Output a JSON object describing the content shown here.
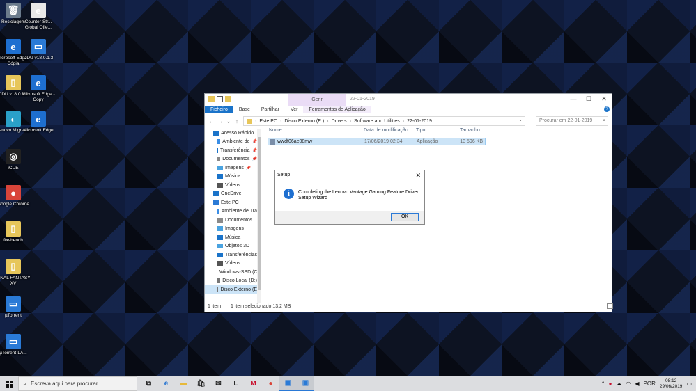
{
  "desktop": {
    "icons": [
      {
        "label": "Reciclagem",
        "glyph": "🗑",
        "color": "#6b7b8c"
      },
      {
        "label": "Counter-Str... Global Offe...",
        "glyph": "e",
        "color": "#e8e8e8"
      },
      {
        "label": "Microsoft Edge - Cópia",
        "glyph": "e",
        "color": "#1e6fd0"
      },
      {
        "label": "DDU v18.0.1.3",
        "glyph": "▭",
        "color": "#2a7ad6"
      },
      {
        "label": "DDU v18.0.1.3",
        "glyph": "▯",
        "color": "#e7c65a"
      },
      {
        "label": "Microsoft Edge - Copy",
        "glyph": "e",
        "color": "#1e6fd0"
      },
      {
        "label": "Lenovo Migrati...",
        "glyph": "◐",
        "color": "#2aa0c8"
      },
      {
        "label": "Microsoft Edge",
        "glyph": "e",
        "color": "#1e6fd0"
      },
      {
        "label": "iCUE",
        "glyph": "◎",
        "color": "#222"
      },
      {
        "label": "Google Chrome",
        "glyph": "●",
        "color": "#d9453a"
      },
      {
        "label": "ffxvbench",
        "glyph": "▯",
        "color": "#e7c65a"
      },
      {
        "label": "FINAL FANTASY XV",
        "glyph": "▯",
        "color": "#e7c65a"
      },
      {
        "label": "µTorrent",
        "glyph": "▭",
        "color": "#2a7ad6"
      },
      {
        "label": "µTorrent-LA...",
        "glyph": "▭",
        "color": "#2a7ad6"
      }
    ]
  },
  "explorer": {
    "tools_tab": "Gerir",
    "window_title": "22-01-2019",
    "controls": [
      "—",
      "☐",
      "✕"
    ],
    "ribbon_tabs": [
      "Ficheiro",
      "Base",
      "Partilhar",
      "Ver",
      "Ferramentas de Aplicação"
    ],
    "address": [
      "Este PC",
      "Disco Externo (E:)",
      "Drivers",
      "Software and Utilities",
      "22-01-2019"
    ],
    "search_placeholder": "Procurar em 22-01-2019",
    "nav_items": [
      {
        "label": "Acesso Rápido",
        "pin": false,
        "indent": 0,
        "color": "#1a73c9"
      },
      {
        "label": "Ambiente de",
        "pin": true,
        "indent": 1,
        "color": "#3a8ee6"
      },
      {
        "label": "Transferência",
        "pin": true,
        "indent": 1,
        "color": "#1a73c9"
      },
      {
        "label": "Documentos",
        "pin": true,
        "indent": 1,
        "color": "#8a8a8a"
      },
      {
        "label": "Imagens",
        "pin": true,
        "indent": 1,
        "color": "#4aa3e0"
      },
      {
        "label": "Música",
        "pin": false,
        "indent": 1,
        "color": "#1a73c9"
      },
      {
        "label": "Vídeos",
        "pin": false,
        "indent": 1,
        "color": "#555"
      },
      {
        "label": "OneDrive",
        "pin": false,
        "indent": 0,
        "color": "#1a73c9"
      },
      {
        "label": "Este PC",
        "pin": false,
        "indent": 0,
        "color": "#2a7ad6"
      },
      {
        "label": "Ambiente de Tra",
        "pin": false,
        "indent": 1,
        "color": "#3a8ee6"
      },
      {
        "label": "Documentos",
        "pin": false,
        "indent": 1,
        "color": "#8a8a8a"
      },
      {
        "label": "Imagens",
        "pin": false,
        "indent": 1,
        "color": "#4aa3e0"
      },
      {
        "label": "Música",
        "pin": false,
        "indent": 1,
        "color": "#1a73c9"
      },
      {
        "label": "Objetos 3D",
        "pin": false,
        "indent": 1,
        "color": "#4aa3e0"
      },
      {
        "label": "Transferências",
        "pin": false,
        "indent": 1,
        "color": "#1a73c9"
      },
      {
        "label": "Vídeos",
        "pin": false,
        "indent": 1,
        "color": "#555"
      },
      {
        "label": "Windows-SSD (C",
        "pin": false,
        "indent": 1,
        "color": "#777"
      },
      {
        "label": "Disco Local (D:)",
        "pin": false,
        "indent": 1,
        "color": "#777"
      },
      {
        "label": "Disco Externo (E",
        "pin": false,
        "indent": 1,
        "color": "#777"
      }
    ],
    "columns": [
      "Nome",
      "Data de modificação",
      "Tipo",
      "Tamanho"
    ],
    "file": {
      "name": "wwdf06ae08mw",
      "date": "17/06/2019 02:34",
      "type": "Aplicação",
      "size": "13 596 KB"
    },
    "status_count": "1 item",
    "status_selected": "1 item selecionado  13,2 MB"
  },
  "dialog": {
    "title": "Setup",
    "close": "✕",
    "message": "Completing the Lenovo Vantage Gaming Feature Driver Setup Wizard",
    "ok": "OK"
  },
  "taskbar": {
    "search_placeholder": "Escreva aqui para procurar",
    "apps": [
      {
        "name": "task-view",
        "glyph": "⧉",
        "color": "#222"
      },
      {
        "name": "edge",
        "glyph": "e",
        "color": "#1e6fd0"
      },
      {
        "name": "file-explorer",
        "glyph": "▬",
        "color": "#e7b93a"
      },
      {
        "name": "store",
        "glyph": "🛍",
        "color": "#222"
      },
      {
        "name": "mail",
        "glyph": "✉",
        "color": "#222"
      },
      {
        "name": "lenovo-l",
        "glyph": "L",
        "color": "#000"
      },
      {
        "name": "mcafee",
        "glyph": "M",
        "color": "#c8102e"
      },
      {
        "name": "chrome",
        "glyph": "●",
        "color": "#d9453a"
      },
      {
        "name": "installer",
        "glyph": "▣",
        "color": "#2a7ad6"
      },
      {
        "name": "installer-active",
        "glyph": "▣",
        "color": "#2a7ad6"
      }
    ],
    "language": "POR",
    "time": "08:12",
    "date": "29/06/2019"
  }
}
